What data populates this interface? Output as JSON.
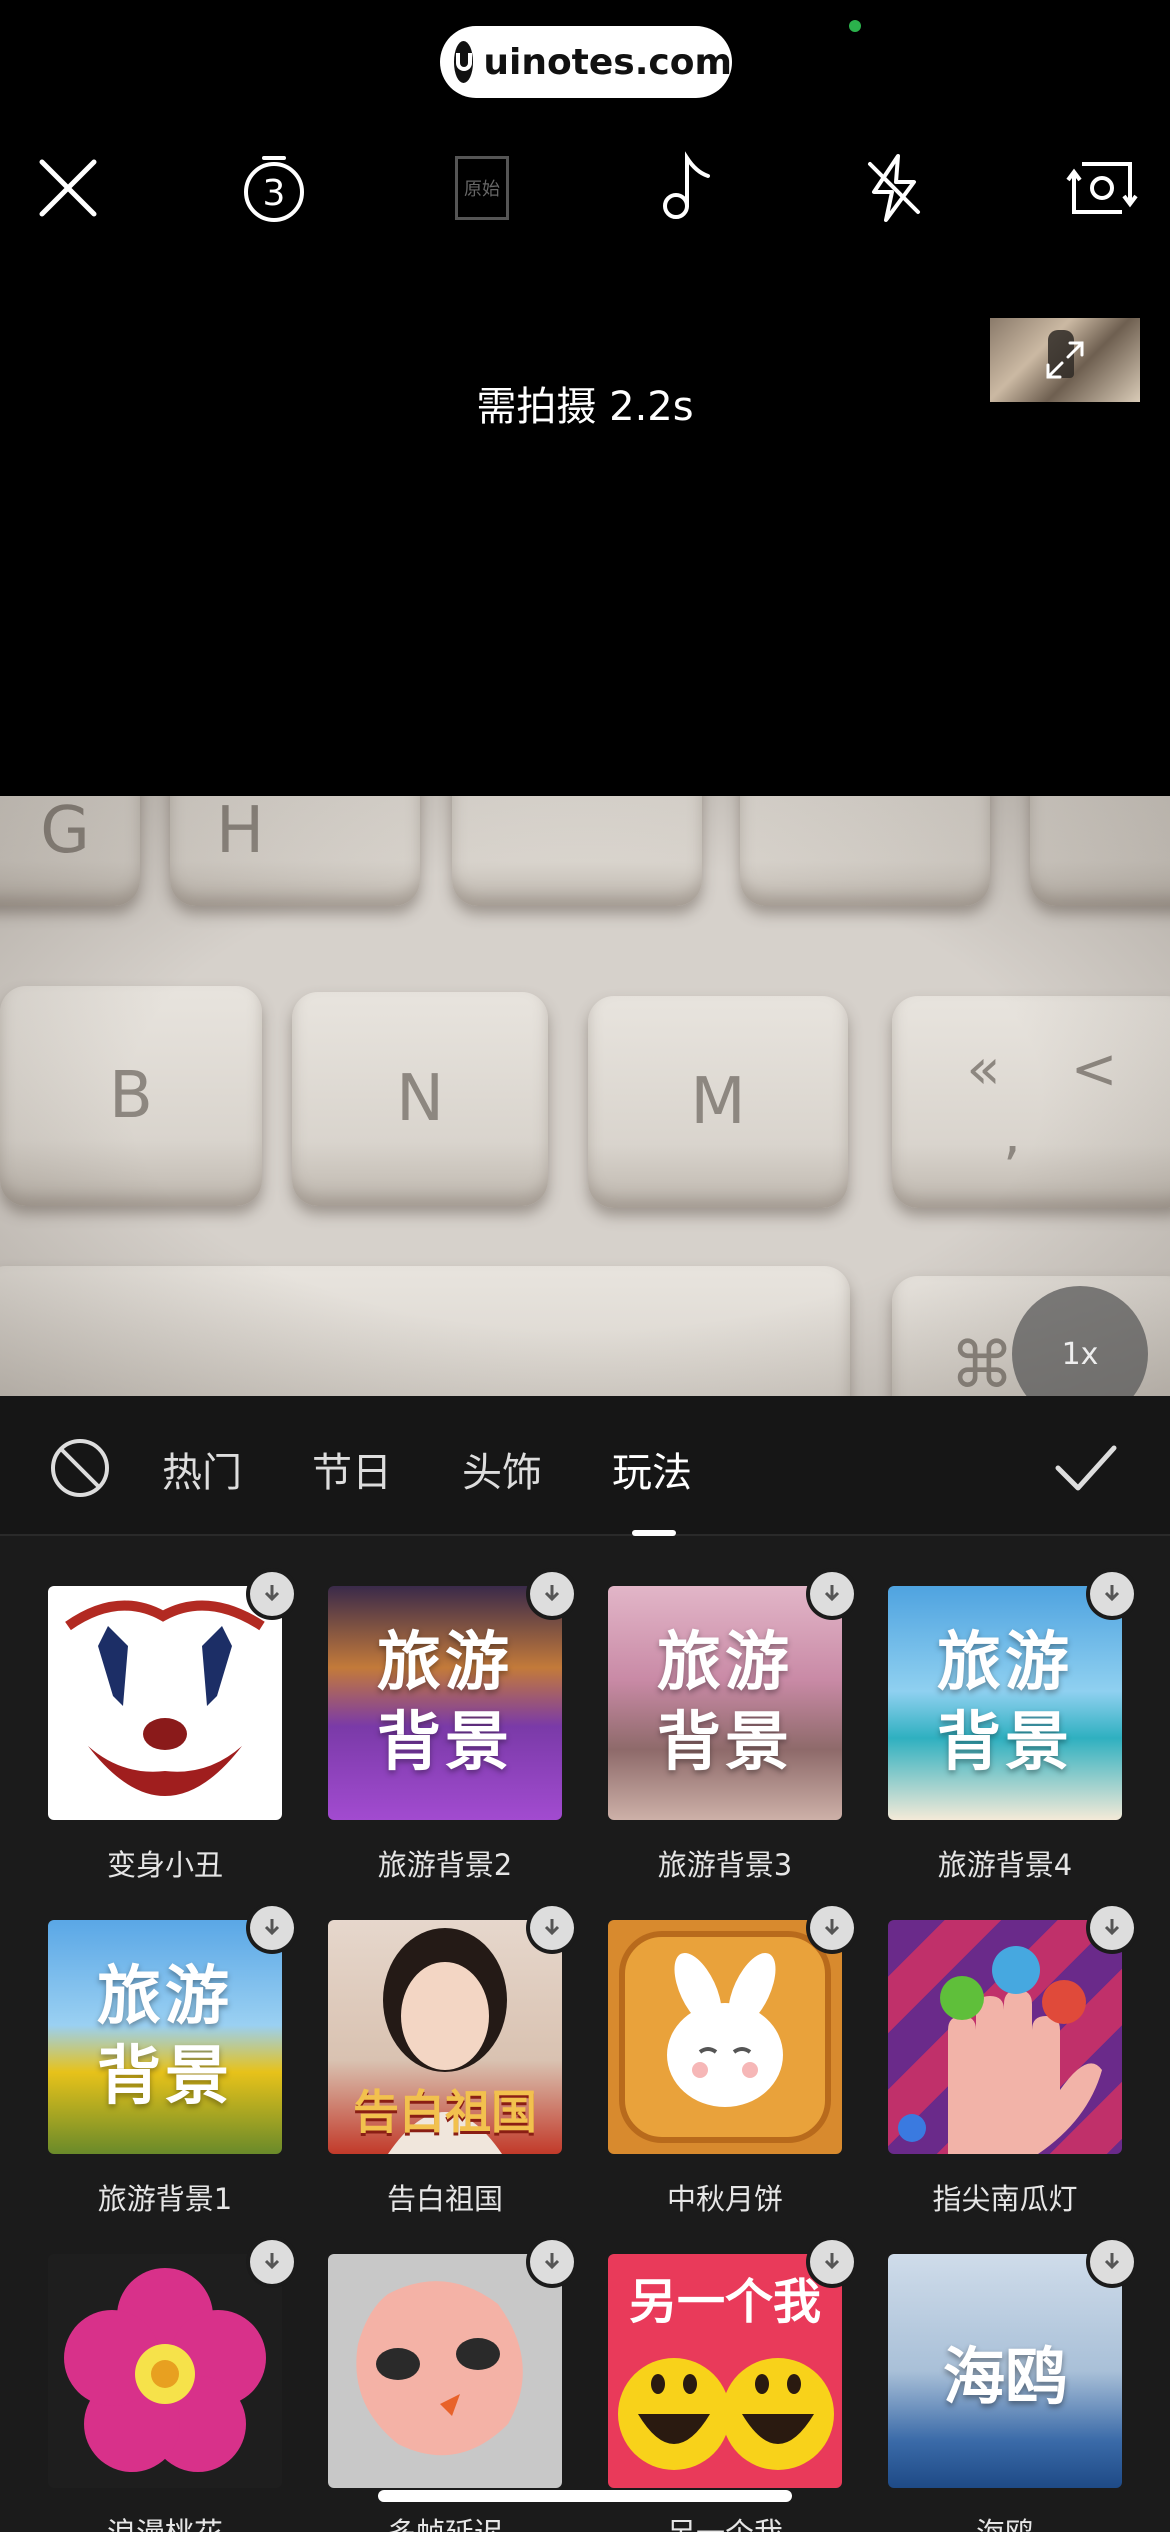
{
  "watermark": {
    "text": "uinotes.com"
  },
  "toolbar": {
    "close_icon": "close-icon",
    "timer_icon": "timer-3-icon",
    "timer_value": "3",
    "original_label": "原始",
    "music_icon": "music-note-icon",
    "flash_icon": "flash-off-icon",
    "flip_icon": "flip-camera-icon"
  },
  "status": {
    "need_shoot": "需拍摄 2.2s"
  },
  "preview": {
    "keys": [
      "G",
      "H",
      "B",
      "N",
      "M",
      "«",
      "<",
      ",",
      "⌘"
    ],
    "zoom": "1x"
  },
  "panel": {
    "tabs": [
      {
        "label": "热门",
        "active": false
      },
      {
        "label": "节日",
        "active": false
      },
      {
        "label": "头饰",
        "active": false
      },
      {
        "label": "玩法",
        "active": true
      }
    ],
    "items": [
      {
        "label": "变身小丑",
        "thumb_text": ""
      },
      {
        "label": "旅游背景2",
        "thumb_text": "旅游背景"
      },
      {
        "label": "旅游背景3",
        "thumb_text": "旅游背景"
      },
      {
        "label": "旅游背景4",
        "thumb_text": "旅游背景"
      },
      {
        "label": "旅游背景1",
        "thumb_text": "旅游背景"
      },
      {
        "label": "告白祖国",
        "thumb_text": "告白祖国"
      },
      {
        "label": "中秋月饼",
        "thumb_text": ""
      },
      {
        "label": "指尖南瓜灯",
        "thumb_text": ""
      },
      {
        "label": "浪漫桃花",
        "thumb_text": ""
      },
      {
        "label": "多帧延迟",
        "thumb_text": ""
      },
      {
        "label": "另一个我",
        "thumb_text": "另一个我"
      },
      {
        "label": "海鸥",
        "thumb_text": "海鸥"
      }
    ]
  },
  "colors": {
    "background": "#000000",
    "panel": "#1b1b1b",
    "accent": "#ffffff"
  }
}
